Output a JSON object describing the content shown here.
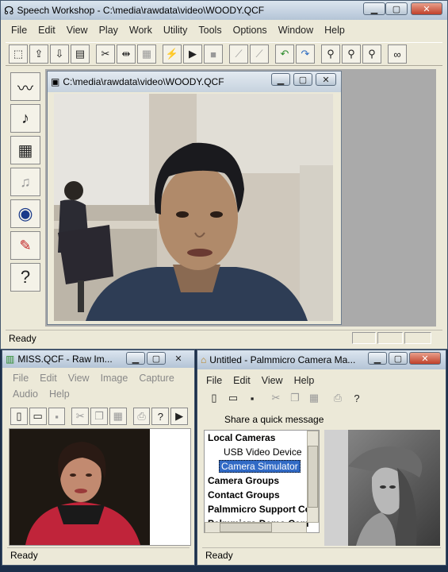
{
  "main": {
    "title": "Speech Workshop - C:\\media\\rawdata\\video\\WOODY.QCF",
    "menu": [
      "File",
      "Edit",
      "View",
      "Play",
      "Work",
      "Utility",
      "Tools",
      "Options",
      "Window",
      "Help"
    ],
    "status": "Ready",
    "child": {
      "title": "C:\\media\\rawdata\\video\\WOODY.QCF"
    }
  },
  "miss": {
    "title": "MISS.QCF - Raw Im...",
    "menu": [
      "File",
      "Edit",
      "View",
      "Image",
      "Capture",
      "Audio",
      "Help"
    ],
    "status": "Ready"
  },
  "cam": {
    "title": "Untitled - Palmmicro Camera Ma...",
    "menu": [
      "File",
      "Edit",
      "View",
      "Help"
    ],
    "quick": "Share a quick message",
    "tree": [
      {
        "label": "Local Cameras",
        "bold": true
      },
      {
        "label": "USB Video Device",
        "bold": false
      },
      {
        "label": "Camera Simulator",
        "bold": false,
        "selected": true
      },
      {
        "label": "Camera Groups",
        "bold": true
      },
      {
        "label": "Contact Groups",
        "bold": true
      },
      {
        "label": "Palmmicro Support Co",
        "bold": true
      },
      {
        "label": "Palmmicro Demo Cam",
        "bold": true
      }
    ],
    "status": "Ready"
  },
  "colors": {
    "titlebar": "#c8d5e3",
    "face_bg": "#cfc8bc",
    "selection": "#316ac5"
  }
}
